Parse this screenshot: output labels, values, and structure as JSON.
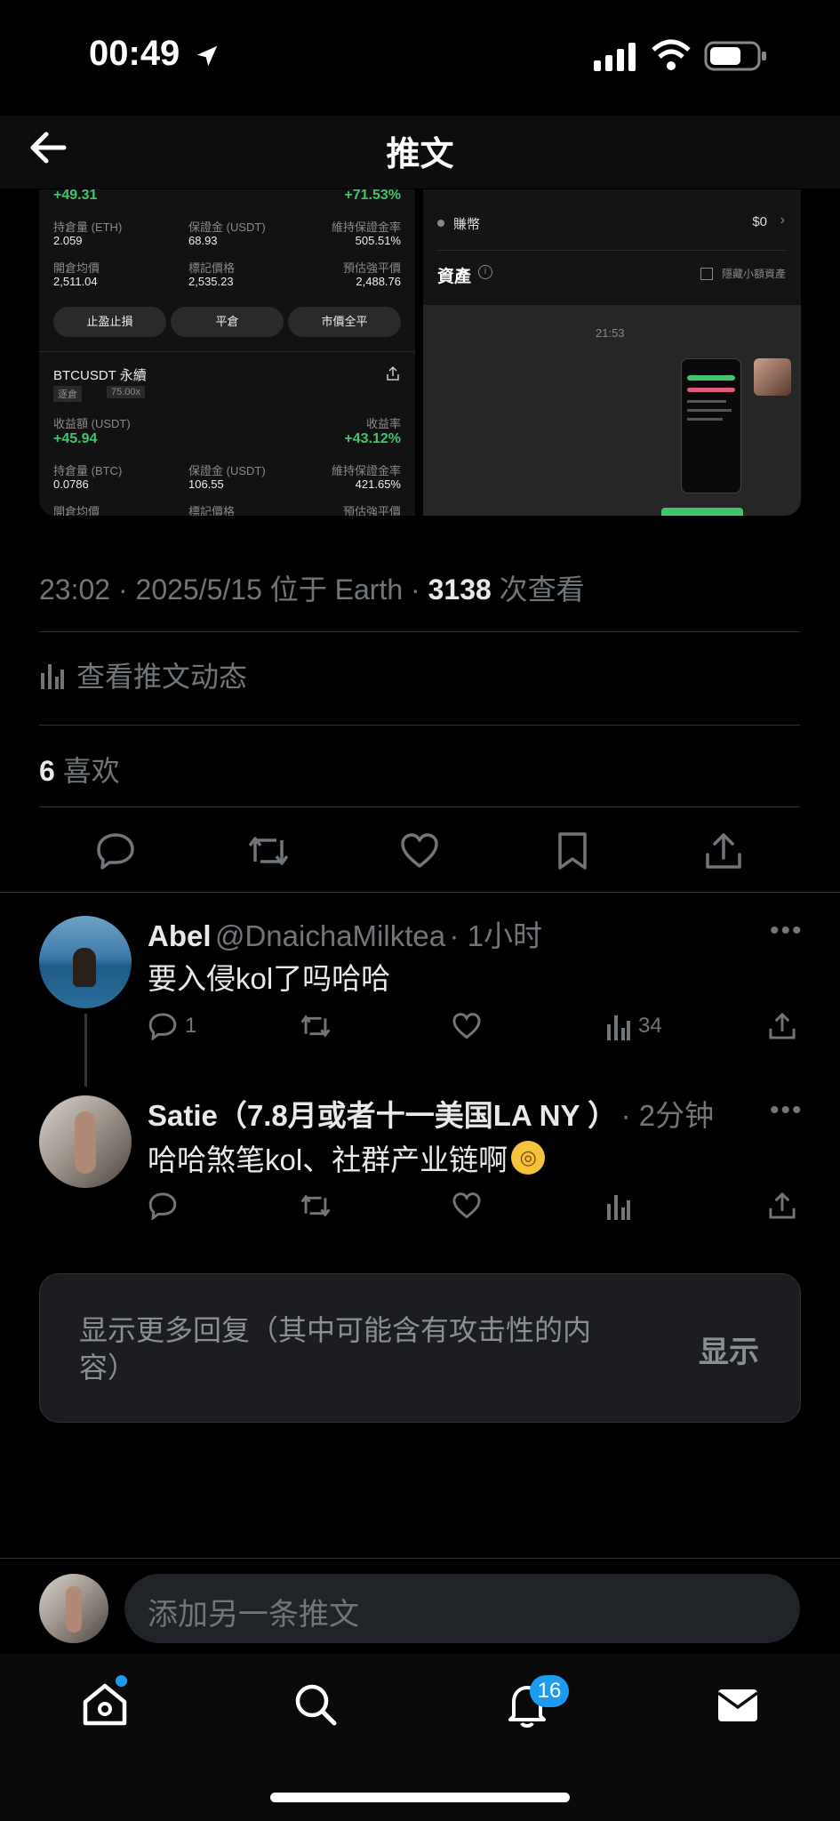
{
  "status_bar": {
    "time": "00:49"
  },
  "header": {
    "title": "推文"
  },
  "image_left": {
    "pnl_top": "+49.31",
    "roe_top": "+71.53%",
    "eth_labels": [
      "持倉量 (ETH)",
      "保證金 (USDT)",
      "維持保證金率"
    ],
    "eth_values": [
      "2.059",
      "68.93",
      "505.51%"
    ],
    "eth_labels2": [
      "開倉均價",
      "標記價格",
      "預估強平價"
    ],
    "eth_values2": [
      "2,511.04",
      "2,535.23",
      "2,488.76"
    ],
    "buttons": [
      "止盈止損",
      "平倉",
      "市價全平"
    ],
    "btc_title": "BTCUSDT 永續",
    "btc_tags": [
      "逐倉",
      "75.00x"
    ],
    "btc_label_pnl": "收益額 (USDT)",
    "btc_label_roe": "收益率",
    "btc_pnl": "+45.94",
    "btc_roe": "+43.12%",
    "btc_labels": [
      "持倉量 (BTC)",
      "保證金 (USDT)",
      "維持保證金率"
    ],
    "btc_values": [
      "0.0786",
      "106.55",
      "421.65%"
    ],
    "btc_labels2": [
      "開倉均價",
      "標記價格",
      "預估強平價"
    ]
  },
  "image_right": {
    "earn_label": "賺幣",
    "earn_value": "$0",
    "assets_label": "資產",
    "hide_label": "隱藏小額資產",
    "video_time": "21:53"
  },
  "tweet_meta": {
    "time_date": "23:02 · 2025/5/15 位于 Earth · ",
    "views": "3138",
    "views_label": " 次查看"
  },
  "activity_label": "查看推文动态",
  "likes": {
    "count": "6",
    "label": " 喜欢"
  },
  "replies": [
    {
      "name": "Abel",
      "handle": "@DnaichaMilktea",
      "time": "· 1小时",
      "text": "要入侵kol了吗哈哈",
      "reply_count": "1",
      "view_count": "34"
    },
    {
      "name": "Satie（7.8月或者十一美国LA NY ）",
      "handle": "",
      "time": "· 2分钟",
      "text": "哈哈煞笔kol、社群产业链啊",
      "reply_count": "",
      "view_count": ""
    }
  ],
  "more_replies": {
    "text": "显示更多回复（其中可能含有攻击性的内容）",
    "button": "显示"
  },
  "compose": {
    "placeholder": "添加另一条推文"
  },
  "tabbar": {
    "notifications_badge": "16"
  },
  "colors": {
    "accent": "#1d9bf0",
    "green": "#3fc56b",
    "muted": "#71767b"
  }
}
